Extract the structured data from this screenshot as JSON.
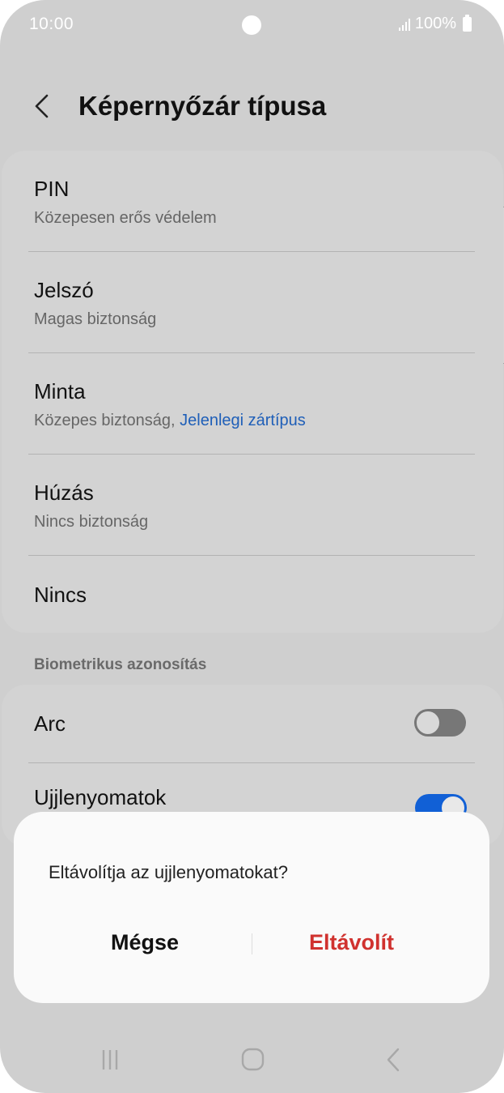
{
  "status_bar": {
    "time": "10:00",
    "battery": "100%"
  },
  "header": {
    "title": "Képernyőzár típusa"
  },
  "lock_types": [
    {
      "title": "PIN",
      "subtitle": "Közepesen erős védelem"
    },
    {
      "title": "Jelszó",
      "subtitle": "Magas biztonság"
    },
    {
      "title": "Minta",
      "subtitle": "Közepes biztonság, ",
      "subtitle_highlight": "Jelenlegi zártípus"
    },
    {
      "title": "Húzás",
      "subtitle": "Nincs biztonság"
    },
    {
      "title": "Nincs"
    }
  ],
  "biometrics": {
    "section_title": "Biometrikus azonosítás",
    "items": [
      {
        "title": "Arc",
        "enabled": false
      },
      {
        "title": "Ujjlenyomatok",
        "enabled": true
      }
    ]
  },
  "dialog": {
    "message": "Eltávolítja az ujjlenyomatokat?",
    "cancel_label": "Mégse",
    "remove_label": "Eltávolít"
  },
  "colors": {
    "accent": "#1160d6",
    "destructive": "#d0322f",
    "link": "#1f5fb8"
  },
  "icons": {
    "back": "chevron-left-icon",
    "nav_recents": "recents-icon",
    "nav_home": "home-icon",
    "nav_back": "back-icon"
  }
}
